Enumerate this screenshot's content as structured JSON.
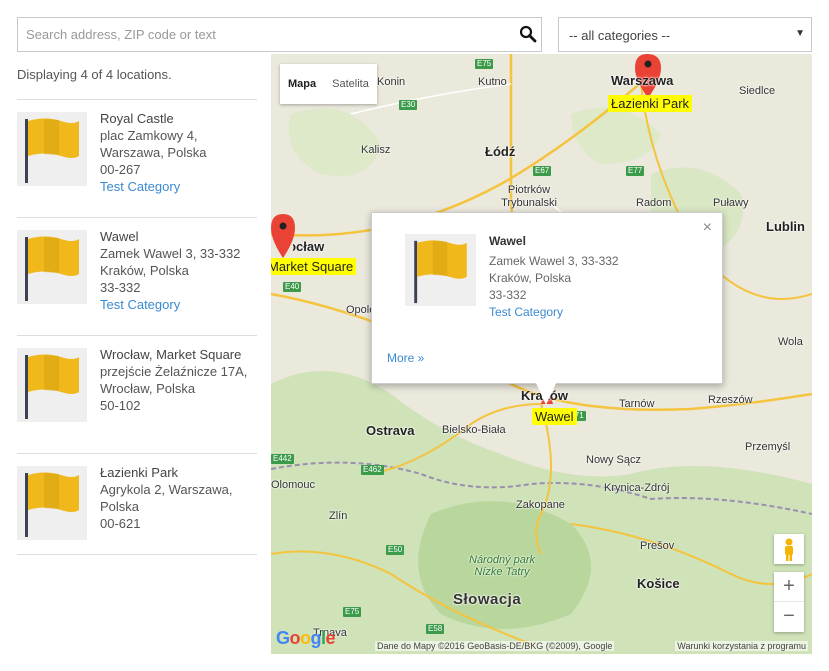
{
  "search": {
    "placeholder": "Search address, ZIP code or text"
  },
  "categories": {
    "selected": "-- all categories --"
  },
  "status": {
    "count_text": "Displaying 4 of 4 locations."
  },
  "locations": [
    {
      "name": "Royal Castle",
      "line1": "plac Zamkowy 4,",
      "line2": "Warszawa, Polska",
      "zip": "00-267",
      "category": "Test Category"
    },
    {
      "name": "Wawel",
      "line1": "Zamek Wawel 3, 33-332",
      "line2": "Kraków, Polska",
      "zip": "33-332",
      "category": "Test Category"
    },
    {
      "name": "Wrocław, Market Square",
      "line1": "przejście Żelaźnicze 17A,",
      "line2": "Wrocław, Polska",
      "zip": "50-102",
      "category": "Test Category"
    },
    {
      "name": "Łazienki Park",
      "line1": "Agrykola 2, Warszawa,",
      "line2": "Polska",
      "zip": "00-621",
      "category": ""
    }
  ],
  "map": {
    "type_map": "Mapa",
    "type_satellite": "Satelita",
    "cities": {
      "warszawa": "Warszawa",
      "konin": "Konin",
      "kutno": "Kutno",
      "siedlce": "Siedlce",
      "kalisz": "Kalisz",
      "lodz": "Łódź",
      "piotrkow": "Piotrków Trybunalski",
      "radom": "Radom",
      "pulawy": "Puławy",
      "lublin": "Lublin",
      "wroclaw": "Wrocław",
      "opole": "Opole",
      "ostrava": "Ostrava",
      "bielsko": "Bielsko-Biała",
      "krakow": "Kraków",
      "tarnow": "Tarnów",
      "rzeszow": "Rzeszów",
      "przemysl": "Przemyśl",
      "nowysacz": "Nowy Sącz",
      "krynica": "Krynica-Zdrój",
      "olomouc": "Olomouc",
      "zlin": "Zlín",
      "zakopane": "Zakopane",
      "presov": "Prešov",
      "kosice": "Košice",
      "trnava": "Trnava",
      "wola": "Wola",
      "slovakia": "Słowacja",
      "park1": "Národný park",
      "park2": "Nízke Tatry"
    },
    "roads": [
      "E75",
      "E30",
      "E67",
      "E77",
      "E40",
      "E462",
      "E442",
      "E50",
      "E75",
      "E58",
      "E371"
    ],
    "marker_labels": {
      "lazienki": "Łazienki Park",
      "market": "Market Square",
      "wawel": "Wawel"
    },
    "attribution": "Dane do Mapy ©2016 GeoBasis-DE/BKG (©2009), Google",
    "terms": "Warunki korzystania z programu",
    "logo": "Google"
  },
  "info_window": {
    "name": "Wawel",
    "line1": "Zamek Wawel 3, 33-332",
    "line2": "Kraków, Polska",
    "zip": "33-332",
    "category": "Test Category",
    "more": "More »",
    "close": "×"
  },
  "colors": {
    "link": "#3a8ad0",
    "flag": "#f0b81b",
    "highlight": "#ffff00",
    "marker": "#ea4335"
  }
}
